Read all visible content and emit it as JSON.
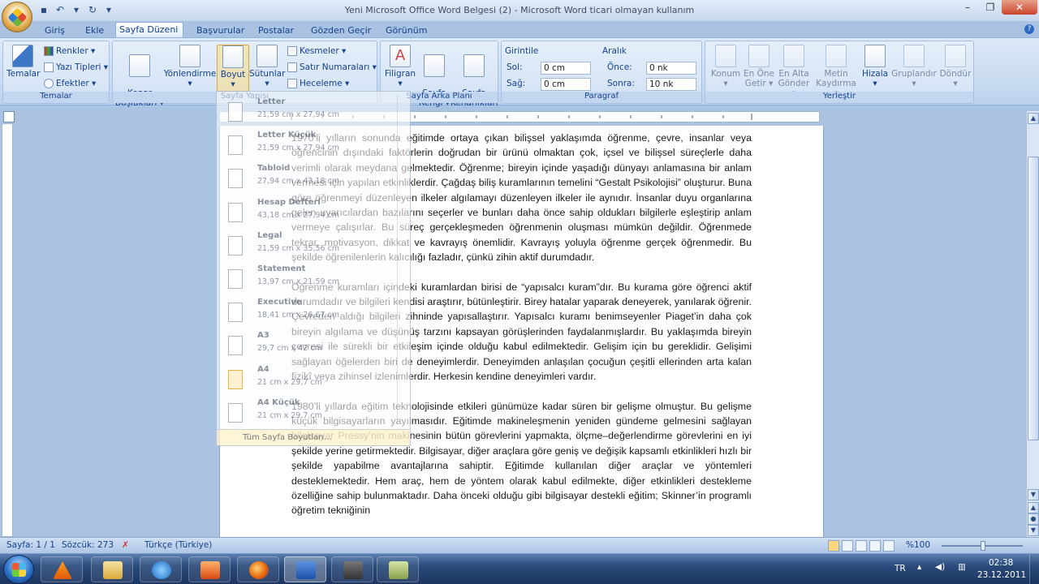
{
  "window": {
    "title": "Yeni Microsoft Office Word Belgesi (2) - Microsoft Word ticari olmayan kullanım",
    "controls": [
      "–",
      "❐",
      "✕"
    ]
  },
  "tabs": [
    "Giriş",
    "Ekle",
    "Sayfa Düzeni",
    "Başvurular",
    "Postalar",
    "Gözden Geçir",
    "Görünüm"
  ],
  "ribbon": {
    "temalar": {
      "big": "Temalar",
      "renkler": "Renkler ▾",
      "yazi_tipleri": "Yazı Tipleri ▾",
      "efektler": "Efektler ▾",
      "label": "Temalar"
    },
    "sayfa_yapisi": {
      "kenar": "Kenar\nBoşlukları ▾",
      "yonlendirme": "Yönlendirme ▾",
      "boyut": "Boyut ▾",
      "sutunlar": "Sütunlar ▾",
      "kesmeler": "Kesmeler ▾",
      "satir_numaralari": "Satır Numaraları ▾",
      "heceleme": "Heceleme ▾",
      "label": "Sayfa Yapısı"
    },
    "sayfa_arka_plani": {
      "filigran": "Filigran ▾",
      "sayfa_rengi": "Sayfa\nRengi ▾",
      "sayfa_kenarliklari": "Sayfa\nKenarlıkları",
      "label": "Sayfa Arka Planı"
    },
    "paragraf": {
      "girinti": "Girintile",
      "sol": "Sol:",
      "sol_val": "0 cm",
      "sag": "Sağ:",
      "sag_val": "0 cm",
      "aralik": "Aralık",
      "once": "Önce:",
      "once_val": "0 nk",
      "sonra": "Sonra:",
      "sonra_val": "10 nk",
      "label": "Paragraf"
    },
    "yerlestir": {
      "konum": "Konum ▾",
      "en_one_getir": "En Öne\nGetir ▾",
      "en_alta_gonder": "En Alta\nGönder ▾",
      "metin_kaydirma": "Metin\nKaydırma ▾",
      "hizala": "Hizala ▾",
      "grupla": "Gruplandır ▾",
      "dondur": "Döndür ▾",
      "label": "Yerleştir"
    }
  },
  "size_menu": {
    "items": [
      {
        "name": "Letter",
        "size": "21,59 cm x 27,94 cm"
      },
      {
        "name": "Letter Küçük",
        "size": "21,59 cm x 27,94 cm"
      },
      {
        "name": "Tabloid",
        "size": "27,94 cm x 43,18 cm"
      },
      {
        "name": "Hesap Defteri",
        "size": "43,18 cm x 27,94 cm"
      },
      {
        "name": "Legal",
        "size": "21,59 cm x 35,56 cm"
      },
      {
        "name": "Statement",
        "size": "13,97 cm x 21,59 cm"
      },
      {
        "name": "Executive",
        "size": "18,41 cm x 26,67 cm"
      },
      {
        "name": "A3",
        "size": "29,7 cm x 42 cm"
      },
      {
        "name": "A4",
        "size": "21 cm x 29,7 cm"
      },
      {
        "name": "A4 Küçük",
        "size": "21 cm x 29,7 cm"
      }
    ],
    "selected_index": 8,
    "footer": "Tüm Sayfa Boyutları..."
  },
  "document": {
    "paragraphs": [
      "1970’li yılların sonunda eğitimde ortaya çıkan bilişsel yaklaşımda öğrenme, çevre, insanlar veya öğrencinin dışındaki faktörlerin doğrudan bir ürünü olmaktan çok, içsel ve bilişsel süreçlerle daha verimli olarak meydana gelmektedir. Öğrenme; bireyin içinde yaşadığı dünyayı anlamasına bir anlam vermesi için yapılan etkinliklerdir. Çağdaş biliş kuramlarının temelini “Gestalt Psikolojisi” oluşturur. Buna göre öğrenmeyi düzenleyen ilkeler algılamayı düzenleyen ilkeler ile aynıdır. İnsanlar duyu organlarına gelen uyarıcılardan bazılarını seçerler ve bunları daha önce sahip oldukları bilgilerle eşleştirip anlam vermeye çalışırlar. Bu süreç gerçekleşmeden öğrenmenin oluşması mümkün değildir. Öğrenmede tekrar, motivasyon, dikkat ve kavrayış önemlidir. Kavrayış yoluyla öğrenme gerçek öğrenmedir. Bu şekilde öğrenilenlerin kalıcılığı fazladır, çünkü zihin aktif durumdadır.",
      "Öğrenme kuramları içindeki kuramlardan birisi de “yapısalcı kuram”dır. Bu kurama göre öğrenci aktif durumdadır ve bilgileri kendisi araştırır, bütünleştirir. Birey hatalar yaparak deneyerek, yanılarak öğrenir. Çevreden aldığı bilgileri zihninde yapısallaştırır. Yapısalcı kuramı benimseyenler Piaget’in daha çok bireyin algılama ve düşünüş tarzını kapsayan görüşlerinden faydalanmışlardır. Bu yaklaşımda bireyin çevresi ile sürekli bir etkileşim içinde olduğu kabul edilmektedir. Gelişim için bu gereklidir. Gelişimi sağlayan öğelerden biri de deneyimlerdir. Deneyimden anlaşılan çocuğun çeşitli ellerinden arta kalan fizikî veya zihinsel izlenimlerdir. Herkesin kendine deneyimleri vardır.",
      "1980’li yıllarda eğitim teknolojisinde etkileri günümüze kadar süren bir gelişme olmuştur. Bu gelişme küçük bilgisayarların yayılmasıdır. Eğitimde makineleşmenin yeniden gündeme gelmesini sağlayan bilgisayar Pressy’nin makinesinin bütün görevlerini yapmakta, ölçme–değerlendirme görevlerini en iyi şekilde yerine getirmektedir. Bilgisayar, diğer araçlara göre geniş ve değişik kapsamlı etkinlikleri hızlı bir şekilde yapabilme avantajlarına sahiptir. Eğitimde kullanılan diğer araçlar ve yöntemleri desteklemektedir. Hem araç, hem de yöntem olarak kabul edilmekte, diğer etkinlikleri destekleme özelliğine sahip bulunmaktadır. Daha önceki olduğu gibi bilgisayar destekli eğitim; Skinner’in programlı öğretim tekniğinin"
    ]
  },
  "status": {
    "page": "Sayfa: 1 / 1",
    "words": "Sözcük: 273",
    "language": "Türkçe (Türkiye)",
    "zoom": "%100"
  },
  "taskbar": {
    "lang": "TR",
    "time": "02:38",
    "date": "23.12.2011"
  }
}
